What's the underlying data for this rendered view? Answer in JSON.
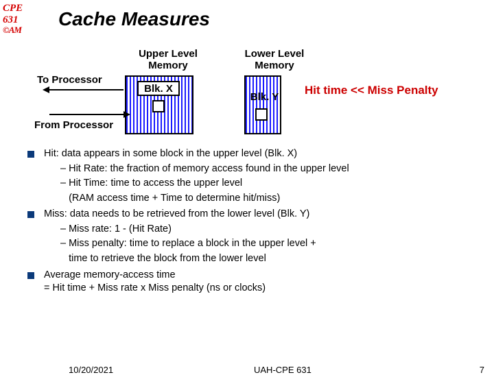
{
  "logo": {
    "line1": "CPE",
    "line2": "631",
    "line3": "©AM"
  },
  "title": "Cache Measures",
  "diagram": {
    "upper_label": "Upper Level\nMemory",
    "lower_label": "Lower Level\nMemory",
    "to_proc": "To Processor",
    "from_proc": "From Processor",
    "blkx": "Blk. X",
    "blky": "Blk. Y",
    "hit_line": "Hit time << Miss Penalty"
  },
  "bullets": [
    {
      "text": "Hit: data appears in some block in the upper level  (Blk. X)",
      "subs": [
        "– Hit Rate: the fraction of memory access found in the upper level",
        "– Hit Time: time to access the upper level",
        "   (RAM access time + Time to determine hit/miss)"
      ]
    },
    {
      "text": "Miss: data needs to be retrieved from the lower level (Blk. Y)",
      "subs": [
        "– Miss rate: 1 - (Hit Rate)",
        "– Miss penalty: time to replace a block in the upper level +",
        "   time to retrieve the block from the lower level"
      ]
    },
    {
      "text": "Average memory-access time\n            = Hit time + Miss rate x Miss penalty (ns or clocks)",
      "subs": []
    }
  ],
  "footer": {
    "date": "10/20/2021",
    "mid": "UAH-CPE 631",
    "page": "7"
  }
}
